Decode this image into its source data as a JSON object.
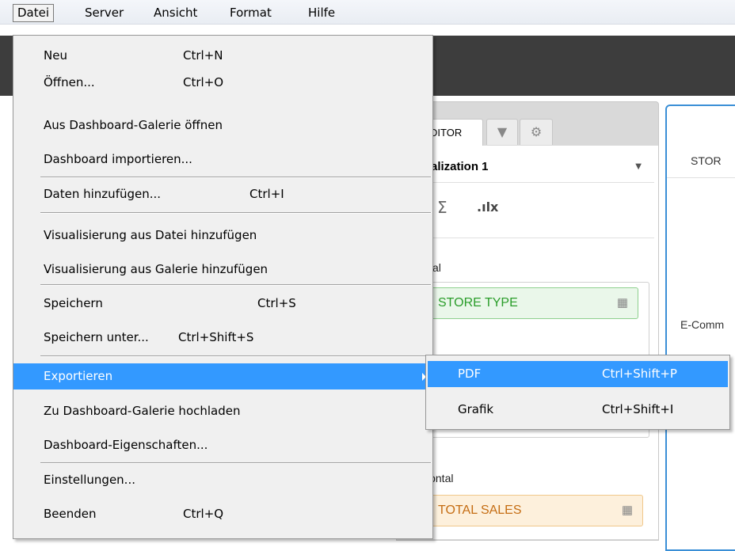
{
  "menubar": {
    "items": [
      {
        "label": "Datei"
      },
      {
        "label": "Server"
      },
      {
        "label": "Ansicht"
      },
      {
        "label": "Format"
      },
      {
        "label": "Hilfe"
      }
    ]
  },
  "file_menu": {
    "items": [
      {
        "label": "Neu",
        "shortcut": "Ctrl+N"
      },
      {
        "label": "Öffnen...",
        "shortcut": "Ctrl+O"
      },
      {
        "label": "Aus Dashboard-Galerie öffnen",
        "shortcut": ""
      },
      {
        "label": "Dashboard importieren...",
        "shortcut": ""
      },
      {
        "label": "Daten hinzufügen...",
        "shortcut": "Ctrl+I"
      },
      {
        "label": "Visualisierung aus Datei hinzufügen",
        "shortcut": ""
      },
      {
        "label": "Visualisierung aus Galerie hinzufügen",
        "shortcut": ""
      },
      {
        "label": "Speichern",
        "shortcut": "Ctrl+S"
      },
      {
        "label": "Speichern unter...",
        "shortcut": "Ctrl+Shift+S"
      },
      {
        "label": "Exportieren",
        "shortcut": "",
        "highlighted": true,
        "has_submenu": true
      },
      {
        "label": "Zu Dashboard-Galerie hochladen",
        "shortcut": ""
      },
      {
        "label": "Dashboard-Eigenschaften...",
        "shortcut": ""
      },
      {
        "label": "Einstellungen...",
        "shortcut": ""
      },
      {
        "label": "Beenden",
        "shortcut": "Ctrl+Q"
      }
    ]
  },
  "export_submenu": {
    "items": [
      {
        "label": "PDF",
        "shortcut": "Ctrl+Shift+P",
        "highlighted": true
      },
      {
        "label": "Grafik",
        "shortcut": "Ctrl+Shift+I"
      }
    ]
  },
  "editor": {
    "tab_label": "DITOR",
    "filter_icon": "filter-icon",
    "settings_icon": "gear-icon",
    "visualization_name": "alization 1",
    "sum_icon": "Σ",
    "vertical_label": "tikal",
    "vertical_field": "STORE TYPE",
    "horizontal_label": "izontal",
    "horizontal_field": "TOTAL SALES"
  },
  "preview": {
    "header": "STOR",
    "row_label": "E-Comm"
  },
  "colors": {
    "highlight": "#3399ff",
    "menu_bg": "#f0f0f0",
    "dark_bar": "#3d3d3d",
    "accent_border": "#3a8fd6"
  }
}
